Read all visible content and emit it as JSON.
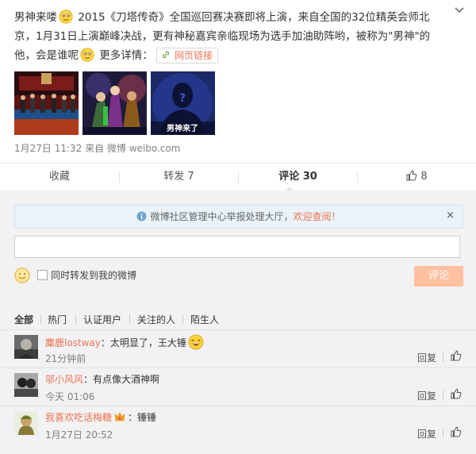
{
  "post": {
    "text_1": "男神来喽",
    "text_2": " 2015《刀塔传奇》全国巡回赛决赛即将上演，来自全国的32位精英会师北京，1月31日上演巅峰决战，更有神秘嘉宾亲临现场为选手加油助阵哟，被称为\"男神\"的他，会是谁呢",
    "text_3": " 更多详情：",
    "web_link_label": "网页链接",
    "images": [
      {
        "icon": "tournament-stage-photo"
      },
      {
        "icon": "game-heroes-art"
      },
      {
        "icon": "mystery-silhouette",
        "caption": "男神来了"
      }
    ],
    "meta": "1月27日 11:32 来自 微博 weibo.com"
  },
  "actions": {
    "favorite": "收藏",
    "forward": "转发 7",
    "comment": "评论 30",
    "like_count": "8"
  },
  "comment_form": {
    "notice_prefix": "微博社区管理中心举报处理大厅，",
    "notice_link": "欢迎查阅！",
    "notice_close": "×",
    "input_value": "",
    "also_forward_label": "同时转发到我的微博",
    "submit_label": "评论"
  },
  "filters": [
    "全部",
    "热门",
    "认证用户",
    "关注的人",
    "陌生人"
  ],
  "comments": [
    {
      "user": "麋鹿lostway",
      "text": "：太明显了，王大锤",
      "time": "21分钟前",
      "reply": "回复"
    },
    {
      "user": "邬小风风",
      "text": "：有点像大酒神啊",
      "time": "今天 01:06",
      "reply": "回复"
    },
    {
      "user": "我喜欢吃话梅糖",
      "text": "：锤锤",
      "time": "1月27日 20:52",
      "reply": "回复"
    }
  ],
  "colors": {
    "link": "#eb7350",
    "submit_bg": "#ffc09f",
    "panel_bg": "#f2f2f5",
    "notice_bg": "#eaf3f9"
  }
}
